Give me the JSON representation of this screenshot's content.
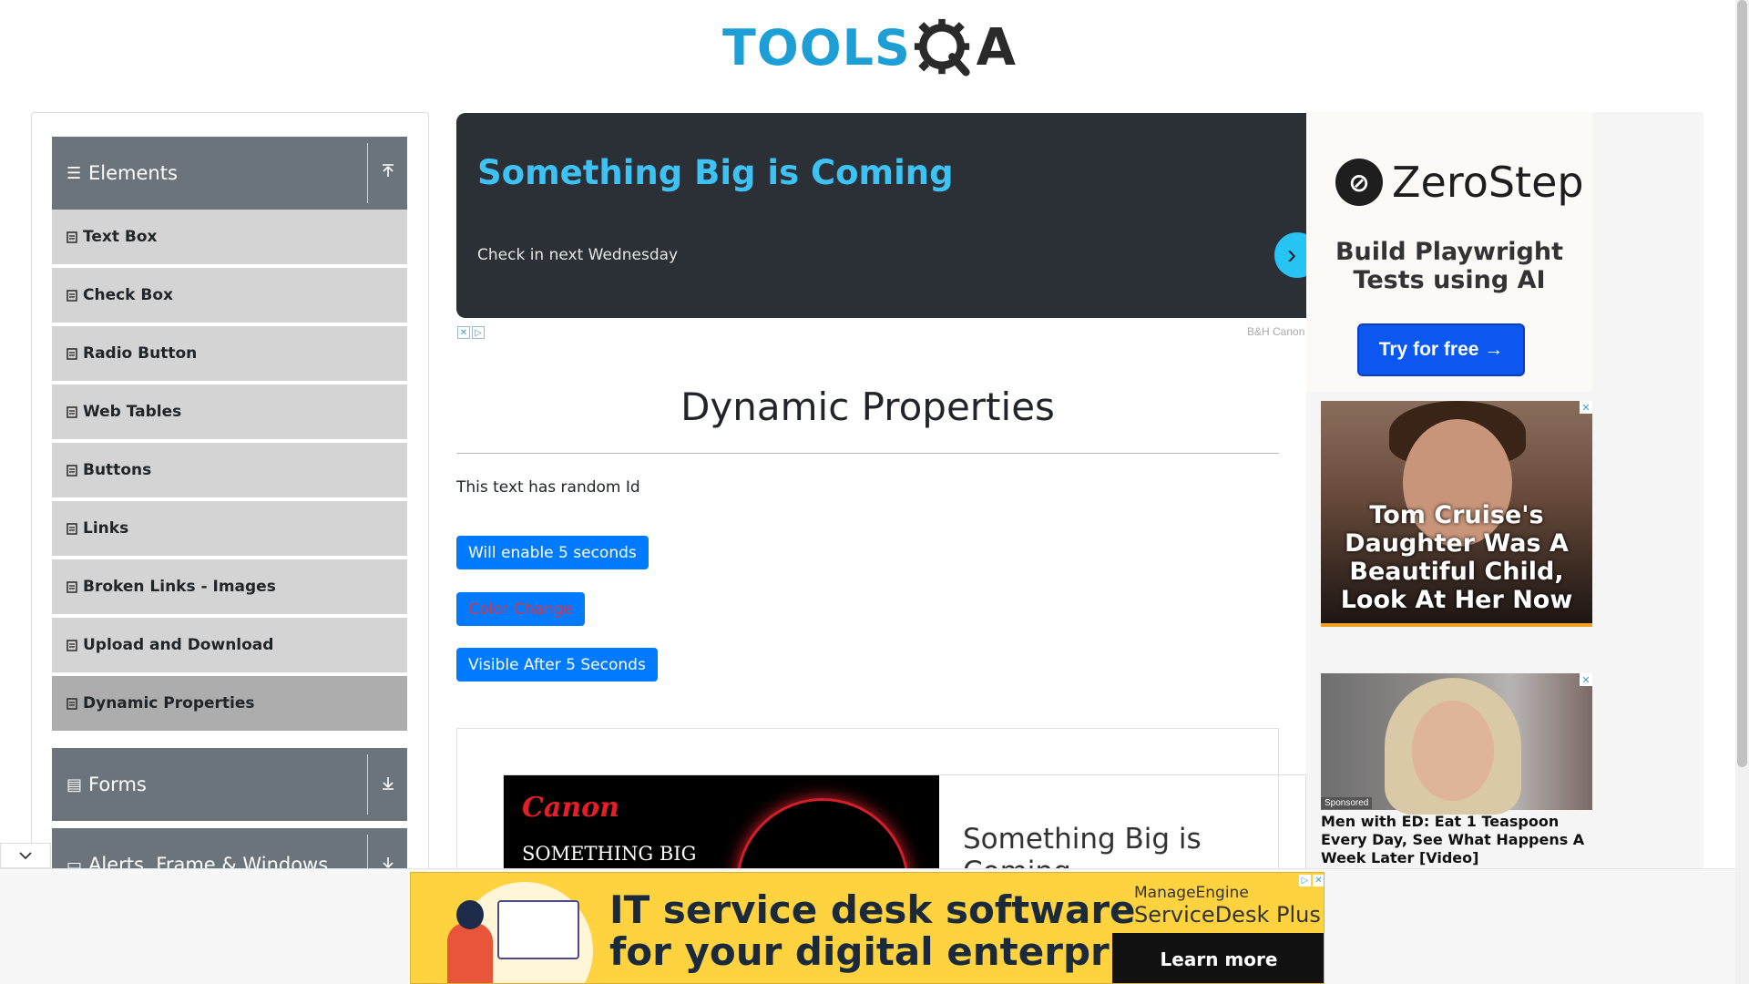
{
  "header": {
    "logo_tools": "TOOLS",
    "logo_qa": "A"
  },
  "sidebar": {
    "groups": [
      {
        "label": "Elements",
        "icon": "hamburger-icon",
        "arrow": "upload-arrow-icon"
      },
      {
        "label": "Forms",
        "icon": "file-icon",
        "arrow": "download-arrow-icon"
      },
      {
        "label": "Alerts, Frame & Windows",
        "icon": "window-icon",
        "arrow": "download-arrow-icon"
      }
    ],
    "items": [
      {
        "label": "Text Box"
      },
      {
        "label": "Check Box"
      },
      {
        "label": "Radio Button"
      },
      {
        "label": "Web Tables"
      },
      {
        "label": "Buttons"
      },
      {
        "label": "Links"
      },
      {
        "label": "Broken Links - Images"
      },
      {
        "label": "Upload and Download"
      },
      {
        "label": "Dynamic Properties",
        "active": true
      }
    ]
  },
  "top_ad": {
    "title": "Something Big is Coming",
    "subtitle": "Check in next Wednesday",
    "source": "B&H Canon"
  },
  "main": {
    "title": "Dynamic Properties",
    "random_text": "This text has random Id",
    "buttons": {
      "enable": "Will enable 5 seconds",
      "color_change": "Color Change",
      "visible_after": "Visible After 5 Seconds"
    },
    "accent_color": "#007bff",
    "danger_color": "#dc3545"
  },
  "canon_ad": {
    "brand": "Canon",
    "sub": "SOMETHING BIG",
    "headline": "Something Big is Coming"
  },
  "zerostep_ad": {
    "name": "ZeroStep",
    "tagline_1": "Build Playwright",
    "tagline_2": "Tests using AI",
    "cta": "Try for free →"
  },
  "celebrity_ad": {
    "headline": "Tom Cruise's Daughter Was A Beautiful Child, Look At Her Now"
  },
  "health_ad": {
    "badge": "Sponsored",
    "headline": "Men with ED: Eat 1 Teaspoon Every Day, See What Happens A Week Later [Video]"
  },
  "bottom_ad": {
    "line1": "IT service desk software",
    "line2": "for your digital enterprise",
    "brand_small": "ManageEngine",
    "brand_product": "ServiceDesk Plus",
    "cta": "Learn more"
  }
}
